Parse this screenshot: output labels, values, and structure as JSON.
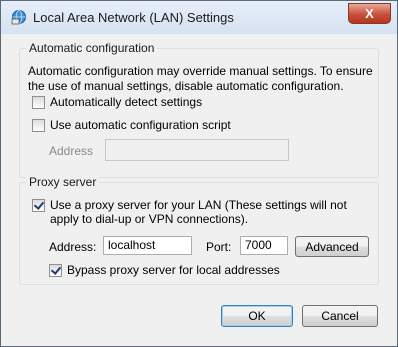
{
  "window": {
    "title": "Local Area Network (LAN) Settings",
    "close_glyph": "X",
    "icon": "network-settings-icon"
  },
  "auto_config": {
    "legend": "Automatic configuration",
    "description": "Automatic configuration may override manual settings.  To ensure the use of manual settings, disable automatic configuration.",
    "detect_label": "Automatically detect settings",
    "detect_checked": false,
    "script_label": "Use automatic configuration script",
    "script_checked": false,
    "address_label": "Address",
    "address_value": ""
  },
  "proxy": {
    "legend": "Proxy server",
    "use_proxy_label": "Use a proxy server for your LAN (These settings will not apply to dial-up or VPN connections).",
    "use_proxy_checked": true,
    "address_label": "Address:",
    "address_value": "localhost",
    "port_label": "Port:",
    "port_value": "7000",
    "advanced_label": "Advanced",
    "bypass_label": "Bypass proxy server for local addresses",
    "bypass_checked": true
  },
  "footer": {
    "ok_label": "OK",
    "cancel_label": "Cancel"
  },
  "colors": {
    "titlebar": "#dbe6f4",
    "close_button": "#c7503a",
    "dialog_bg": "#f0f0f0"
  }
}
